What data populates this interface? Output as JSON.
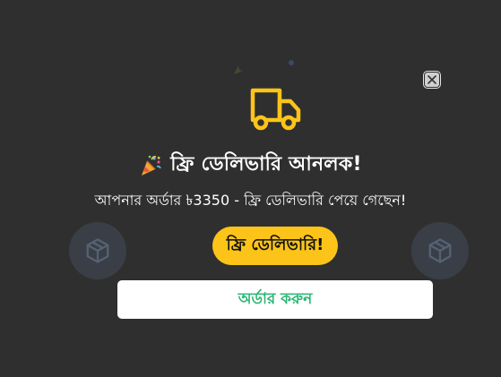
{
  "colors": {
    "backdrop": "#2f2f2f",
    "accent_yellow": "#fcc419",
    "order_text_green": "#2bb673",
    "white": "#ffffff"
  },
  "icons": {
    "truck": "truck-icon",
    "party": "party-popper-icon",
    "close": "close-icon",
    "background_box": "package-box-icon"
  },
  "popup": {
    "headline": "ফ্রি ডেলিভারি আনলক!",
    "subline": "আপনার অর্ডার ৳3350 - ফ্রি ডেলিভারি পেয়ে গেছেন!",
    "badge_label": "ফ্রি ডেলিভারি!",
    "order_button_label": "অর্ডার করুন"
  }
}
